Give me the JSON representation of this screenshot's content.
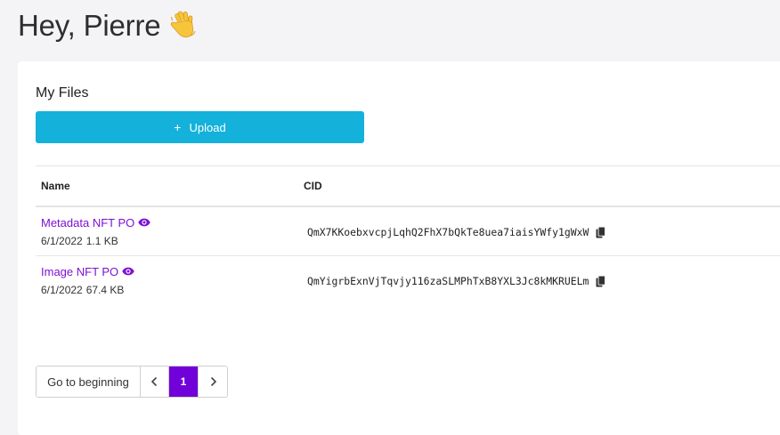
{
  "greeting": {
    "text": "Hey, Pierre",
    "emoji": "waving-hand-icon"
  },
  "files": {
    "title": "My Files",
    "upload_label": "Upload",
    "upload_icon": "plus-icon",
    "accent_color": "#14b1da",
    "link_color": "#7e10d3",
    "columns": [
      "Name",
      "CID"
    ],
    "rows": [
      {
        "name": "Metadata NFT PO",
        "date": "6/1/2022",
        "size": "1.1 KB",
        "cid": "QmX7KKoebxvcpjLqhQ2FhX7bQkTe8uea7iaisYWfy1gWxW"
      },
      {
        "name": "Image NFT PO",
        "date": "6/1/2022",
        "size": "67.4 KB",
        "cid": "QmYigrbExnVjTqvjy116zaSLMPhTxB8YXL3Jc8kMKRUELm"
      }
    ]
  },
  "pagination": {
    "begin_label": "Go to beginning",
    "prev_icon": "chevron-left-icon",
    "next_icon": "chevron-right-icon",
    "current_page": "1",
    "active_color": "#7200d8"
  }
}
